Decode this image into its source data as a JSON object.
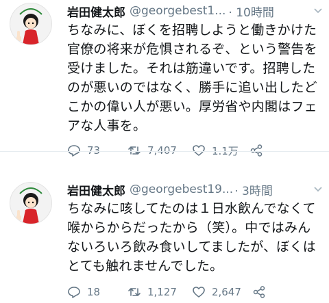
{
  "tweets": [
    {
      "name": "岩田健太郎",
      "handle": "@georgebest1...",
      "time": "· 10時間",
      "text": "ちなみに、ぼくを招聘しようと働きかけた官僚の将来が危惧されるぞ、という警告を受けました。それは筋違いです。招聘したのが悪いのではなく、勝手に追い出したどこかの偉い人が悪い。厚労省や内閣はフェアな人事を。",
      "reply_count": "73",
      "retweet_count": "7,407",
      "like_count": "1.1万"
    },
    {
      "name": "岩田健太郎",
      "handle": "@georgebest19...",
      "time": "· 3時間",
      "text": "ちなみに咳してたのは１日水飲んでなくて喉からからだったから（笑）。中ではみんないろいろ飲み食いしてましたが、ぼくはとても触れませんでした。",
      "reply_count": "18",
      "retweet_count": "1,127",
      "like_count": "2,647"
    }
  ],
  "icons": {
    "avatar": "cartoon-girl-avatar",
    "caret": "chevron-down-icon",
    "reply": "reply-icon",
    "retweet": "retweet-icon",
    "like": "heart-icon",
    "share": "share-icon"
  },
  "colors": {
    "text": "#14171a",
    "secondary": "#657786",
    "avatar_red": "#d8242a",
    "avatar_green": "#2f8a3c"
  }
}
